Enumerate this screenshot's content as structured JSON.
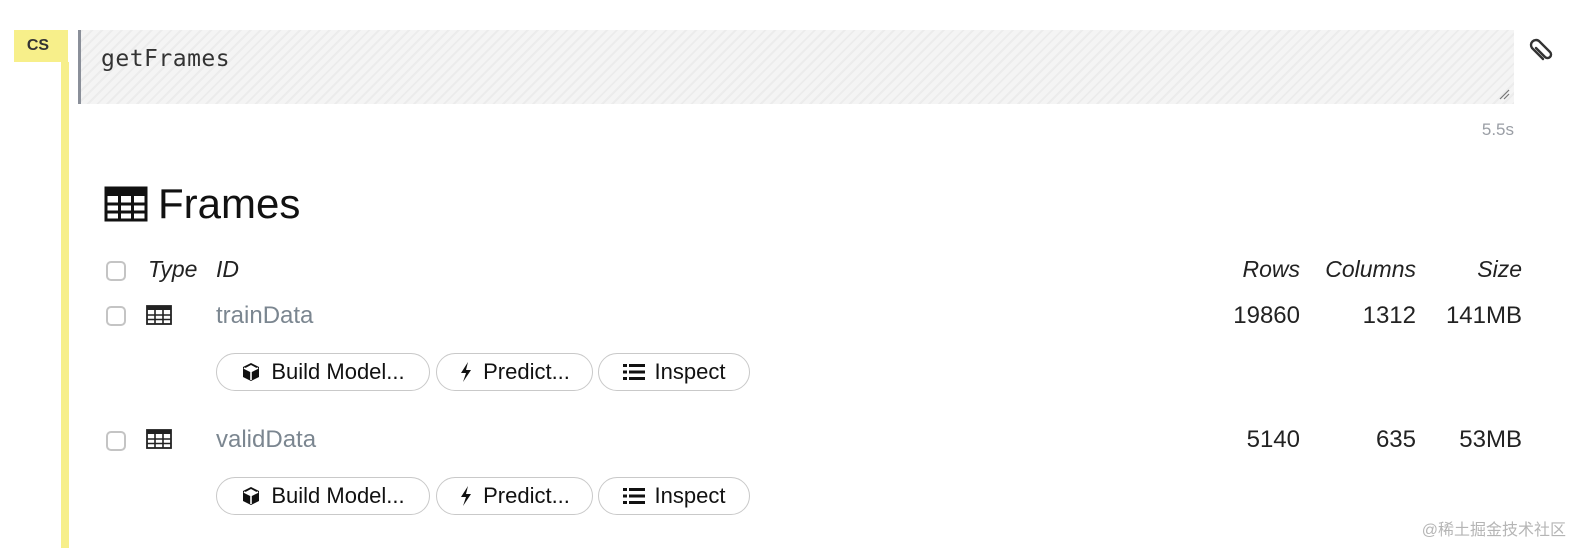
{
  "cell": {
    "badge": "CS",
    "code": "getFrames",
    "elapsed": "5.5s"
  },
  "frames": {
    "title": "Frames",
    "columns": {
      "type": "Type",
      "id": "ID",
      "rows": "Rows",
      "columns": "Columns",
      "size": "Size"
    },
    "rows": [
      {
        "id": "trainData",
        "rows": "19860",
        "columns": "1312",
        "size": "141MB",
        "actions": {
          "build_model": "Build Model...",
          "predict": "Predict...",
          "inspect": "Inspect"
        }
      },
      {
        "id": "validData",
        "rows": "5140",
        "columns": "635",
        "size": "53MB",
        "actions": {
          "build_model": "Build Model...",
          "predict": "Predict...",
          "inspect": "Inspect"
        }
      }
    ]
  },
  "watermark": "@稀土掘金技术社区",
  "colors": {
    "cell_accent": "#f7ef8a",
    "id_link": "#7b8690"
  }
}
